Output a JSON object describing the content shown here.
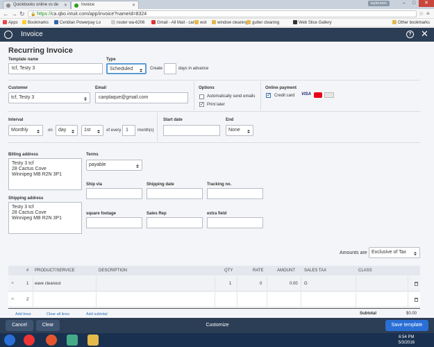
{
  "browser": {
    "tabs": [
      {
        "label": "Quickbooks online vs de"
      },
      {
        "label": "Invoice"
      }
    ],
    "user_chip": "taylor.kern",
    "url_scheme": "https://",
    "url_rest": "ca.qbo.intuit.com/app/invoice?nameId=8324",
    "bookmarks": [
      "Apps",
      "Bookmarks",
      "Ceridian Powerpay Lo",
      "router wa-6206",
      "Gmail - All Mail - can",
      "wot",
      "window cleaning",
      "gutter cleaning",
      "Web Slice Gallery"
    ],
    "other_bookmarks": "Other bookmarks"
  },
  "app": {
    "title": "Invoice",
    "help_label": "?",
    "close_label": "✕"
  },
  "form": {
    "heading": "Recurring Invoice",
    "template_name_label": "Template name",
    "template_name_value": "tcf, Testy 3",
    "type_label": "Type",
    "type_value": "Scheduled",
    "create_label": "Create",
    "create_value": "",
    "days_in_advance": "days in advance",
    "customer_label": "Customer",
    "customer_value": "tcf, Testy 3",
    "email_label": "Email",
    "email_value": "canplaque@gmail.com",
    "options_label": "Options",
    "auto_send_label": "Automatically send emails",
    "auto_send_checked": false,
    "print_later_label": "Print later",
    "print_later_checked": true,
    "online_payment_label": "Online payment",
    "credit_card_label": "Credit card",
    "credit_card_checked": true,
    "card_brands": [
      "VISA",
      "MC",
      "AMEX"
    ],
    "interval_label": "Interval",
    "interval_value": "Monthly",
    "on_label": "on",
    "day_value": "day",
    "day_num_value": "1st",
    "of_every_label": "of every",
    "months_value": "1",
    "months_label": "month(s)",
    "start_date_label": "Start date",
    "start_date_value": "",
    "end_label": "End",
    "end_value": "None",
    "billing_label": "Billing address",
    "billing_lines": [
      "Testy 3 tcf",
      "28 Cactus Cove",
      "Winnipeg MB  R2N 3P1"
    ],
    "shipping_label": "Shipping address",
    "shipping_lines": [
      "Testy 3 tcf",
      "28 Cactus Cove",
      "Winnipeg MB  R2N 3P1"
    ],
    "terms_label": "Terms",
    "terms_value": "payable",
    "ship_via_label": "Ship via",
    "shipping_date_label": "Shipping date",
    "tracking_label": "Tracking no.",
    "square_footage_label": "square footage",
    "sales_rep_label": "Sales Rep",
    "extra_field_label": "extra field",
    "amounts_are_label": "Amounts are",
    "amounts_are_value": "Exclusive of Tax"
  },
  "table": {
    "headers": [
      "#",
      "PRODUCT/SERVICE",
      "DESCRIPTION",
      "QTY",
      "RATE",
      "AMOUNT",
      "SALES TAX",
      "CLASS"
    ],
    "rows": [
      {
        "num": "1",
        "product": "eave cleanout",
        "description": "",
        "qty": "1",
        "rate": "0",
        "amount": "0.00",
        "tax": "G",
        "class": ""
      },
      {
        "num": "2",
        "product": "",
        "description": "",
        "qty": "",
        "rate": "",
        "amount": "",
        "tax": "",
        "class": ""
      }
    ],
    "add_lines": "Add lines",
    "clear_all_lines": "Clear all lines",
    "add_subtotal": "Add subtotal",
    "subtotal_label": "Subtotal",
    "subtotal_value": "$0.00"
  },
  "footer": {
    "cancel": "Cancel",
    "clear": "Clear",
    "customize": "Customize",
    "save_template": "Save template"
  },
  "taskbar": {
    "time": "6:54 PM",
    "date": "5/3/2016"
  },
  "colors": {
    "header_bg": "#2c3e55",
    "primary_button": "#2a6fd6",
    "link": "#2a6fba"
  }
}
